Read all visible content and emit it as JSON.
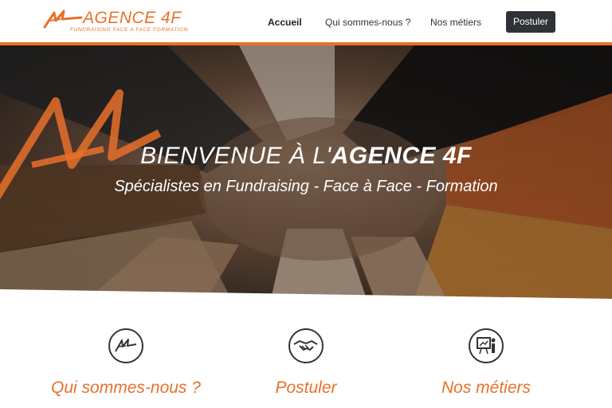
{
  "brand": {
    "name": "AGENCE 4F",
    "tagline": "FUNDRAISING  FACE A FACE  FORMATION",
    "accent_color": "#e8702a",
    "logo_icon": "agence-4f-logo-mark"
  },
  "nav": {
    "items": [
      {
        "label": "Accueil",
        "active": true
      },
      {
        "label": "Qui sommes-nous ?",
        "active": false
      },
      {
        "label": "Nos métiers",
        "active": false
      }
    ],
    "cta_label": "Postuler"
  },
  "hero": {
    "title_prefix": "BIENVENUE À L'",
    "title_emphasis": "AGENCE 4F",
    "subtitle": "Spécialistes en Fundraising - Face à Face - Formation"
  },
  "features": [
    {
      "label": "Qui sommes-nous ?",
      "icon": "agence-4f-icon"
    },
    {
      "label": "Postuler",
      "icon": "handshake-icon"
    },
    {
      "label": "Nos métiers",
      "icon": "presentation-board-icon"
    }
  ]
}
